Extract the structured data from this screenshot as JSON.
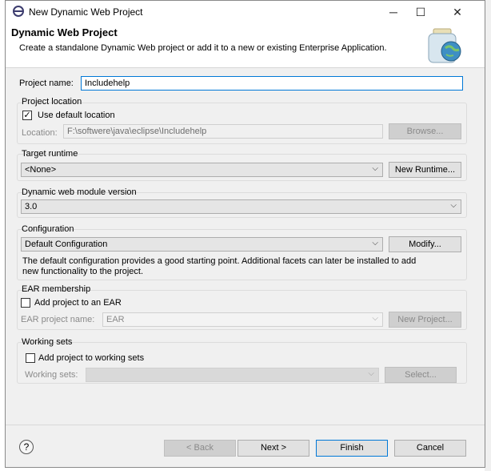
{
  "window": {
    "title": "New Dynamic Web Project",
    "minimize": "─",
    "maximize": "☐",
    "close": "✕"
  },
  "header": {
    "title": "Dynamic Web Project",
    "description": "Create a standalone Dynamic Web project or add it to a new or existing Enterprise Application."
  },
  "project_name": {
    "label": "Project name:",
    "value": "Includehelp"
  },
  "project_location": {
    "title": "Project location",
    "use_default_label": "Use default location",
    "use_default_checked": true,
    "check_glyph": "✓",
    "location_label": "Location:",
    "location_value": "F:\\softwere\\java\\eclipse\\Includehelp",
    "browse_label": "Browse..."
  },
  "target_runtime": {
    "title": "Target runtime",
    "value": "<None>",
    "new_runtime_label": "New Runtime..."
  },
  "module_version": {
    "title": "Dynamic web module version",
    "value": "3.0"
  },
  "configuration": {
    "title": "Configuration",
    "value": "Default Configuration",
    "modify_label": "Modify...",
    "description_line1": "The default configuration provides a good starting point. Additional facets can later be installed to add",
    "description_line2": "new functionality to the project."
  },
  "ear": {
    "title": "EAR membership",
    "add_label": "Add project to an EAR",
    "add_checked": false,
    "project_name_label": "EAR project name:",
    "project_name_value": "EAR",
    "new_project_label": "New Project..."
  },
  "working_sets": {
    "title": "Working sets",
    "add_label": "Add project to working sets",
    "add_checked": false,
    "sets_label": "Working sets:",
    "sets_value": "",
    "select_label": "Select..."
  },
  "footer": {
    "help_glyph": "?",
    "back_label": "< Back",
    "next_label": "Next >",
    "finish_label": "Finish",
    "cancel_label": "Cancel"
  },
  "chevron_glyph": "⌵",
  "colors": {
    "focus_border": "#0078d7",
    "header_bg": "#ffffff",
    "dialog_bg": "#f0f0f0"
  }
}
